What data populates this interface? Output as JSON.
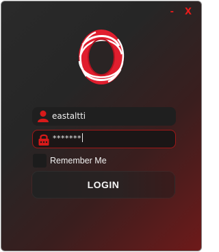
{
  "window": {
    "minimize_label": "-",
    "close_label": "X"
  },
  "login_form": {
    "username_value": "eastaltti",
    "password_value": "*******",
    "remember_label": "Remember Me",
    "remember_checked": false,
    "login_label": "LOGIN"
  },
  "icons": {
    "logo": "ring-logo-icon",
    "username": "user-icon",
    "password": "lock-icon"
  },
  "colors": {
    "accent": "#e81b1b",
    "background_dark": "#262626",
    "background_red": "#6e1a1a"
  }
}
